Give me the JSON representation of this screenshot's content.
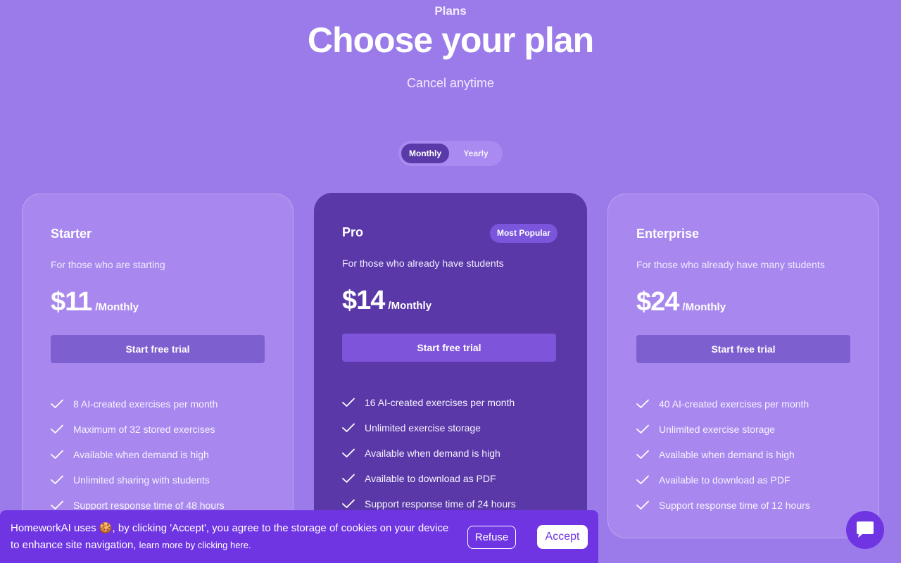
{
  "header": {
    "eyebrow": "Plans",
    "title": "Choose your plan",
    "subtitle": "Cancel anytime"
  },
  "billing_toggle": {
    "options": [
      "Monthly",
      "Yearly"
    ],
    "selected": "Monthly"
  },
  "plans": [
    {
      "name": "Starter",
      "description": "For those who are starting",
      "price": "$11",
      "period": "/Monthly",
      "cta": "Start free trial",
      "features": [
        "8 AI-created exercises per month",
        "Maximum of 32 stored exercises",
        "Available when demand is high",
        "Unlimited sharing with students",
        "Support response time of 48 hours"
      ]
    },
    {
      "name": "Pro",
      "badge": "Most Popular",
      "description": "For those who already have students",
      "price": "$14",
      "period": "/Monthly",
      "cta": "Start free trial",
      "features": [
        "16 AI-created exercises per month",
        "Unlimited exercise storage",
        "Available when demand is high",
        "Available to download as PDF",
        "Support response time of 24 hours"
      ]
    },
    {
      "name": "Enterprise",
      "description": "For those who already have many students",
      "price": "$24",
      "period": "/Monthly",
      "cta": "Start free trial",
      "features": [
        "40 AI-created exercises per month",
        "Unlimited exercise storage",
        "Available when demand is high",
        "Available to download as PDF",
        "Support response time of 12 hours"
      ]
    }
  ],
  "cookie_banner": {
    "text": "HomeworkAI uses 🍪, by clicking 'Accept', you agree to the storage of cookies on your device to enhance site navigation,",
    "link": "learn more by clicking here.",
    "refuse_label": "Refuse",
    "accept_label": "Accept"
  },
  "icons": {
    "feature_check": "check-icon",
    "chat": "chat-bubble-icon"
  },
  "colors": {
    "background": "#9b7bea",
    "pro_card": "#5a38a8",
    "accent": "#6f35e3"
  }
}
